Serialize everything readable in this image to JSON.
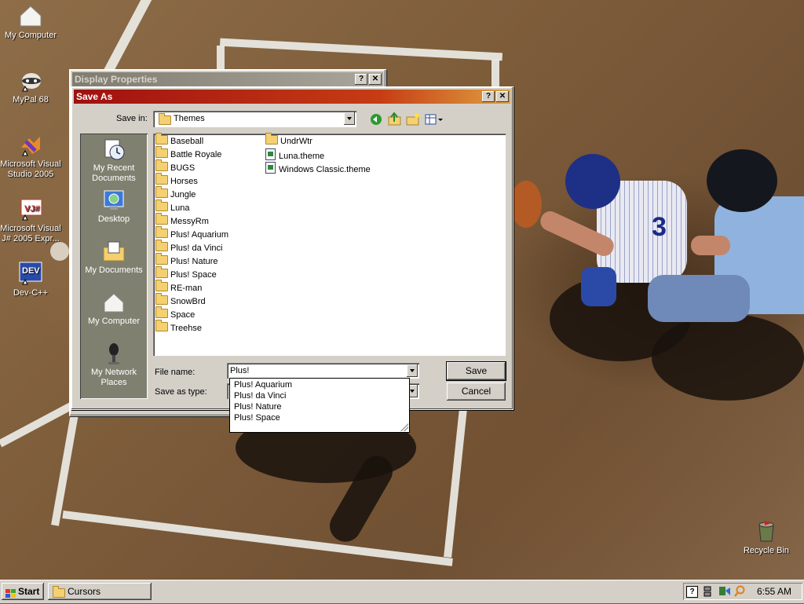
{
  "desktop": {
    "icons": [
      {
        "label": "My Computer",
        "icon": "my-computer-icon"
      },
      {
        "label": "MyPal 68",
        "icon": "mypal-icon"
      },
      {
        "label": "Microsoft Visual Studio 2005",
        "icon": "visual-studio-icon"
      },
      {
        "label": "Microsoft Visual J# 2005 Expr...",
        "icon": "visual-jsharp-icon"
      },
      {
        "label": "Dev-C++",
        "icon": "devcpp-icon"
      },
      {
        "label": "Recycle Bin",
        "icon": "recycle-bin-icon"
      }
    ]
  },
  "display_properties": {
    "title": "Display Properties",
    "help": "?",
    "close": "✕"
  },
  "save_as": {
    "title": "Save As",
    "help": "?",
    "close": "✕",
    "save_in_label": "Save in:",
    "save_in_value": "Themes",
    "places": [
      {
        "label": "My Recent Documents",
        "icon": "recent-documents-icon"
      },
      {
        "label": "Desktop",
        "icon": "desktop-icon"
      },
      {
        "label": "My Documents",
        "icon": "my-documents-icon"
      },
      {
        "label": "My Computer",
        "icon": "my-computer-icon"
      },
      {
        "label": "My Network Places",
        "icon": "network-places-icon"
      }
    ],
    "files_col1": [
      "Baseball",
      "Battle Royale",
      "BUGS",
      "Horses",
      "Jungle",
      "Luna",
      "MessyRm",
      "Plus! Aquarium",
      "Plus! da Vinci",
      "Plus! Nature",
      "Plus! Space",
      "RE-man",
      "SnowBrd",
      "Space",
      "Treehse"
    ],
    "files_col2": [
      {
        "name": "UndrWtr",
        "type": "folder"
      },
      {
        "name": "Luna.theme",
        "type": "theme"
      },
      {
        "name": "Windows Classic.theme",
        "type": "theme"
      }
    ],
    "file_name_label": "File name:",
    "file_name_value": "Plus!",
    "save_as_type_label": "Save as type:",
    "save_button": "Save",
    "cancel_button": "Cancel",
    "autocomplete": [
      "Plus! Aquarium",
      "Plus! da Vinci",
      "Plus! Nature",
      "Plus! Space"
    ]
  },
  "taskbar": {
    "start_label": "Start",
    "task_label": "Cursors",
    "clock": "6:55 AM",
    "tray_help": "?"
  }
}
